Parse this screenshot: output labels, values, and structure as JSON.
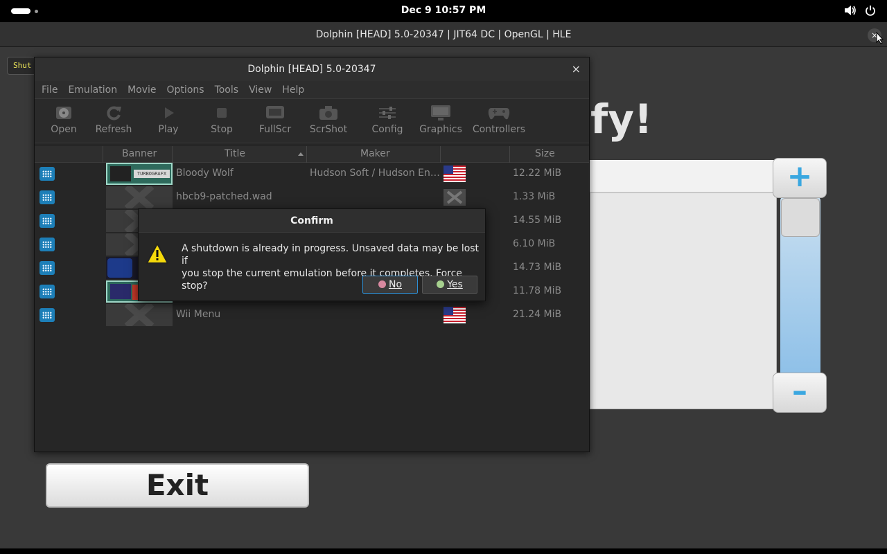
{
  "topbar": {
    "clock": "Dec 9  10:57 PM"
  },
  "render_window": {
    "title": "Dolphin [HEAD] 5.0-20347 | JIT64 DC | OpenGL | HLE",
    "close_label": "×",
    "game_text": "fy!",
    "plus_label": "+",
    "minus_label": "–",
    "exit_label": "Exit",
    "shutdown_tag": "Shut"
  },
  "dolphin": {
    "title": "Dolphin [HEAD] 5.0-20347",
    "close_label": "×",
    "menu": [
      "File",
      "Emulation",
      "Movie",
      "Options",
      "Tools",
      "View",
      "Help"
    ],
    "toolbar": [
      "Open",
      "Refresh",
      "Play",
      "Stop",
      "FullScr",
      "ScrShot",
      "Config",
      "Graphics",
      "Controllers"
    ],
    "columns": {
      "banner": "Banner",
      "title": "Title",
      "maker": "Maker",
      "size": "Size"
    },
    "rows": [
      {
        "title": "Bloody Wolf",
        "maker": "Hudson Soft / Hudson Ent…",
        "size": "12.22 MiB",
        "banner": "turbografx",
        "region": "usa-flag"
      },
      {
        "title": "hbcb9-patched.wad",
        "maker": "",
        "size": "1.33 MiB",
        "banner": "none",
        "region": "unknown-region"
      },
      {
        "title": "",
        "maker": "",
        "size": "14.55 MiB",
        "banner": "none",
        "region": ""
      },
      {
        "title": "",
        "maker": "",
        "size": "6.10 MiB",
        "banner": "none",
        "region": ""
      },
      {
        "title": "",
        "maker": "",
        "size": "14.73 MiB",
        "banner": "sonic",
        "region": ""
      },
      {
        "title": "",
        "maker": "",
        "size": "11.78 MiB",
        "banner": "snes",
        "region": ""
      },
      {
        "title": "Wii Menu",
        "maker": "",
        "size": "21.24 MiB",
        "banner": "none",
        "region": "usa-flag"
      }
    ]
  },
  "dialog": {
    "title": "Confirm",
    "message_line1": "A shutdown is already in progress. Unsaved data may be lost if",
    "message_line2": "you stop the current emulation before it completes. Force stop?",
    "no_label": "No",
    "yes_label": "Yes"
  },
  "colors": {
    "accent_blue": "#2e8fd4",
    "wii_blue": "#3aa7e0",
    "channel_icon": "#1d7fb8"
  }
}
